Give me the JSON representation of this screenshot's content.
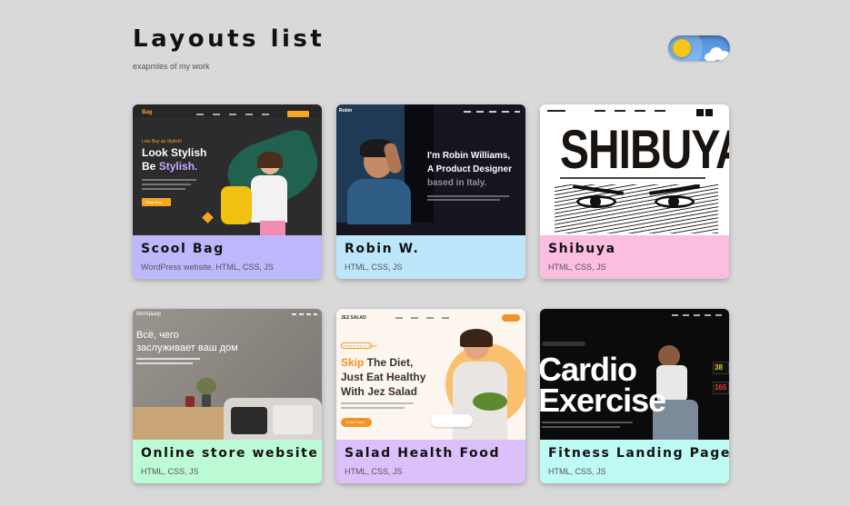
{
  "header": {
    "title": "Layouts list",
    "subtitle": "exapmles of my work"
  },
  "theme_toggle": {
    "icon": "sun-icon"
  },
  "cards": [
    {
      "title": "Scool Bag",
      "desc": "WordPress website. HTML, CSS, JS",
      "info_color": "#bdb7fb",
      "thumb": {
        "logo": "Bag",
        "kicker": "Lets Buy an Stylish!",
        "line1": "Look Stylish",
        "line2a": "Be ",
        "line2b": "Stylish.",
        "cta": "Shop Now"
      }
    },
    {
      "title": "Robin W.",
      "desc": "HTML, CSS, JS",
      "info_color": "#bde6fb",
      "thumb": {
        "logo": "Robin",
        "line1": "I'm Robin Williams,",
        "line2": "A Product Designer",
        "line3": "based in Italy."
      }
    },
    {
      "title": "Shibuya",
      "desc": "HTML, CSS, JS",
      "info_color": "#fbbde0",
      "thumb": {
        "word": "SHIBUYA"
      }
    },
    {
      "title": "Online store website",
      "desc": "HTML, CSS, JS",
      "info_color": "#bdfbd6",
      "thumb": {
        "logo": "Интерьер",
        "line1": "Всё, чего",
        "line2": "заслуживает ваш дом"
      }
    },
    {
      "title": "Salad Health Food",
      "desc": "HTML, CSS, JS",
      "info_color": "#dcc0fb",
      "thumb": {
        "logo": "JEZ SALAD",
        "kicker": "Healthy food & Salad",
        "line1a": "Skip",
        "line1b": " The Diet,",
        "line2": "Just Eat Healthy",
        "line3": "With Jez Salad",
        "cta": "Order Food"
      }
    },
    {
      "title": "Fitness Landing Page",
      "desc": "HTML, CSS, JS",
      "info_color": "#bdfbf4",
      "thumb": {
        "line1": "Cardio",
        "line2": "Exercise",
        "stat1": "38",
        "stat2": "165"
      }
    }
  ]
}
